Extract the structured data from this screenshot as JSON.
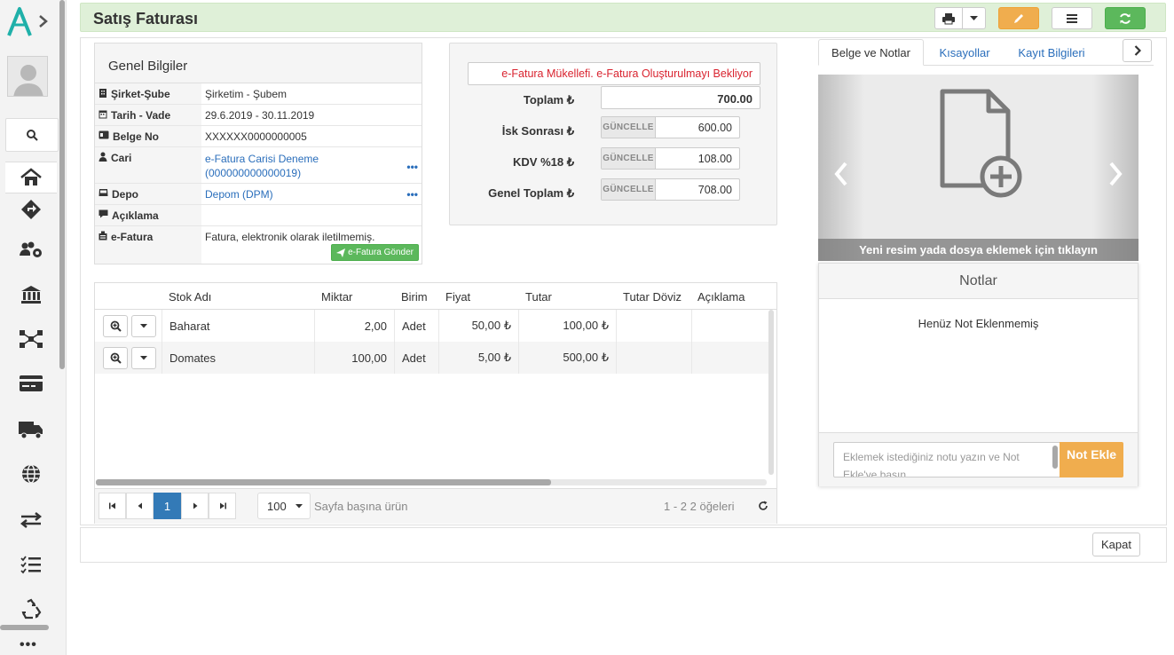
{
  "header": {
    "title": "Satış Faturası"
  },
  "genel_bilgiler": {
    "title": "Genel Bilgiler",
    "rows": [
      {
        "label": "Şirket-Şube",
        "value": "Şirketim - Şubem"
      },
      {
        "label": "Tarih - Vade",
        "value": "29.6.2019 - 30.11.2019"
      },
      {
        "label": "Belge No",
        "value": "XXXXXX0000000005"
      },
      {
        "label": "Cari",
        "value": "e-Fatura Carisi Deneme (000000000000019)"
      },
      {
        "label": "Depo",
        "value": "Depom (DPM)"
      },
      {
        "label": "Açıklama",
        "value": ""
      },
      {
        "label": "e-Fatura",
        "value": "Fatura, elektronik olarak iletilmemiş."
      }
    ],
    "efatura_button": "e-Fatura Gönder"
  },
  "totals": {
    "status": "e-Fatura Mükellefi. e-Fatura Oluşturulmayı Bekliyor",
    "toplam_label": "Toplam ₺",
    "toplam_value": "700.00",
    "isk_label": "İsk Sonrası ₺",
    "isk_value": "600.00",
    "kdv_label": "KDV %18 ₺",
    "kdv_value": "108.00",
    "genel_label": "Genel Toplam ₺",
    "genel_value": "708.00",
    "update_label": "GÜNCELLE"
  },
  "grid": {
    "columns": [
      "Stok Adı",
      "Miktar",
      "Birim",
      "Fiyat",
      "Tutar",
      "Tutar Döviz",
      "Açıklama"
    ],
    "rows": [
      {
        "stok": "Baharat",
        "miktar": "2,00",
        "birim": "Adet",
        "fiyat": "50,00 ₺",
        "tutar": "100,00 ₺",
        "doviz": "",
        "aciklama": ""
      },
      {
        "stok": "Domates",
        "miktar": "100,00",
        "birim": "Adet",
        "fiyat": "5,00 ₺",
        "tutar": "500,00 ₺",
        "doviz": "",
        "aciklama": ""
      }
    ],
    "pager": {
      "current_page": "1",
      "page_size": "100",
      "page_size_label": "Sayfa başına ürün",
      "summary": "1 - 2 2 öğeleri"
    }
  },
  "right_panel": {
    "tabs": [
      "Belge ve Notlar",
      "Kısayollar",
      "Kayıt Bilgileri"
    ],
    "carousel_caption": "Yeni resim yada dosya eklemek için tıklayın",
    "notes_title": "Notlar",
    "notes_empty": "Henüz Not Eklenmemiş",
    "note_placeholder": "Eklemek istediğiniz notu yazın ve Not Ekle'ye basın",
    "note_button": "Not Ekle"
  },
  "footer": {
    "close_button": "Kapat"
  },
  "colors": {
    "header_bg": "#dff0d8",
    "accent_teal": "#1fb0a9",
    "edit_orange": "#f0ad4e",
    "refresh_green": "#5cb85c",
    "link_blue": "#2a6ebb",
    "status_red": "#d9232f"
  }
}
